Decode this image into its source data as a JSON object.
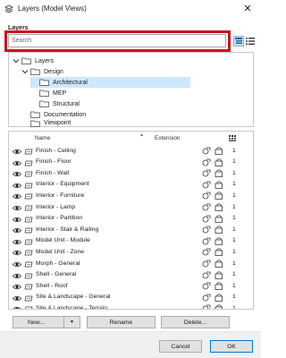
{
  "window": {
    "title": "Layers (Model Views)",
    "close_glyph": "✕",
    "accent": "#d0121b"
  },
  "panel": {
    "section_label": "Layers"
  },
  "search": {
    "placeholder": "Search",
    "value": ""
  },
  "view_buttons": [
    {
      "icon": "tree-view-icon",
      "active": true
    },
    {
      "icon": "list-view-icon",
      "active": false
    }
  ],
  "tree": {
    "items": [
      {
        "label": "Layers",
        "level": 0,
        "expanded": true,
        "selected": false
      },
      {
        "label": "Design",
        "level": 1,
        "expanded": true,
        "selected": false
      },
      {
        "label": "Architectural",
        "level": 2,
        "expanded": false,
        "selected": true
      },
      {
        "label": "MEP",
        "level": 2,
        "expanded": false,
        "selected": false
      },
      {
        "label": "Structural",
        "level": 2,
        "expanded": false,
        "selected": false
      },
      {
        "label": "Documentation",
        "level": 1,
        "expanded": false,
        "selected": false
      },
      {
        "label": "Viewpoint",
        "level": 1,
        "expanded": false,
        "selected": false
      }
    ]
  },
  "table": {
    "columns": {
      "name": "Name",
      "extension": "Extension",
      "sort_glyph": "▲"
    },
    "rows": [
      {
        "name": "Finish - Ceiling",
        "num": "1"
      },
      {
        "name": "Finish - Floor",
        "num": "1"
      },
      {
        "name": "Finish - Wall",
        "num": "1"
      },
      {
        "name": "Interior - Equipment",
        "num": "1"
      },
      {
        "name": "Interior - Furniture",
        "num": "1"
      },
      {
        "name": "Interior - Lamp",
        "num": "1"
      },
      {
        "name": "Interior - Partition",
        "num": "1"
      },
      {
        "name": "Interior - Stair & Railing",
        "num": "1"
      },
      {
        "name": "Model Unit - Module",
        "num": "1"
      },
      {
        "name": "Model Unit - Zone",
        "num": "1"
      },
      {
        "name": "Morph - General",
        "num": "1"
      },
      {
        "name": "Shell - General",
        "num": "1"
      },
      {
        "name": "Shell - Roof",
        "num": "1"
      },
      {
        "name": "Site & Landscape - General",
        "num": "1"
      },
      {
        "name": "Site & Landscape - Terrain",
        "num": "1"
      }
    ]
  },
  "actions": {
    "new": "New...",
    "new_arrow": "▼",
    "rename": "Rename",
    "delete": "Delete..."
  },
  "footer": {
    "cancel": "Cancel",
    "ok": "OK"
  }
}
